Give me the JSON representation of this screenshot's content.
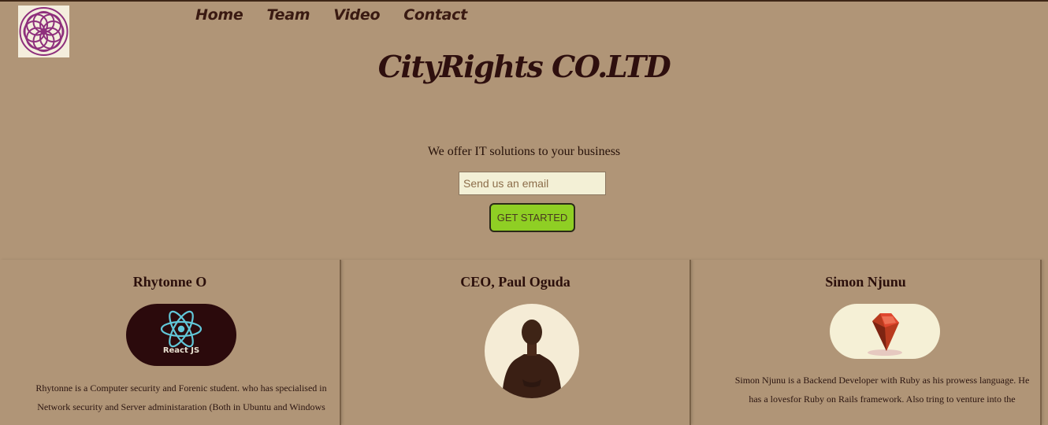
{
  "header": {
    "logo_icon": "mandala-logo-icon",
    "nav": [
      "Home",
      "Team",
      "Video",
      "Contact"
    ]
  },
  "hero": {
    "title": "CityRights CO.LTD",
    "tagline": "We offer IT solutions to your business",
    "email_placeholder": "Send us an email",
    "cta_label": "GET STARTED"
  },
  "team": [
    {
      "name": "Rhytonne O",
      "badge_text": "React JS",
      "badge_icon": "react-atom-icon",
      "bio_lines": [
        "Rhytonne is a Computer security and Forenic student. who has specialised in",
        "Network security and Server administaration (Both in Ubuntu and Windows"
      ]
    },
    {
      "name": "CEO, Paul Oguda",
      "photo_icon": "person-photo-icon",
      "bio_lines": []
    },
    {
      "name": "Simon Njunu",
      "badge_icon": "ruby-gem-icon",
      "bio_lines": [
        "Simon Njunu is a Backend Developer with Ruby as his prowess language. He",
        "has a lovesfor Ruby on Rails framework. Also tring to venture into the"
      ]
    }
  ],
  "colors": {
    "background": "#b09577",
    "cta": "#8fcf24",
    "title": "#2e0f0e"
  }
}
